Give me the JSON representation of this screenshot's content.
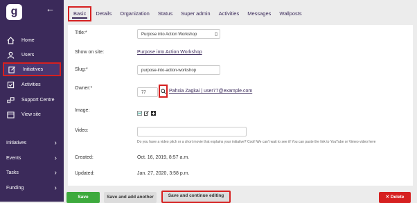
{
  "sidebar": {
    "logo": "g",
    "nav": [
      {
        "label": "Home",
        "icon": "home-icon"
      },
      {
        "label": "Users",
        "icon": "user-icon"
      },
      {
        "label": "Initiatives",
        "icon": "edit-icon"
      },
      {
        "label": "Activities",
        "icon": "checklist-icon"
      },
      {
        "label": "Support Centre",
        "icon": "support-icon"
      },
      {
        "label": "View site",
        "icon": "calendar-icon"
      }
    ],
    "groups": [
      {
        "label": "Initiatives"
      },
      {
        "label": "Events"
      },
      {
        "label": "Tasks"
      },
      {
        "label": "Funding"
      }
    ]
  },
  "tabs": [
    "Basic",
    "Details",
    "Organization",
    "Status",
    "Super admin",
    "Activities",
    "Messages",
    "Wallposts"
  ],
  "form": {
    "title_label": "Title:*",
    "title_value": "Purpose into Action Workshop",
    "show_on_site_label": "Show on site:",
    "show_on_site_value": "Purpose into Action Workshop",
    "slug_label": "Slug:*",
    "slug_value": "purpose-into-action-workshop",
    "owner_label": "Owner:*",
    "owner_id": "77",
    "owner_name": "Pahxia Zagkai | user77@example.com",
    "image_label": "Image:",
    "video_label": "Video:",
    "video_help": "Do you have a video pitch or a short movie that explains your initiative? Cool! We can't wait to see it! You can paste the link to YouTube or Vimeo video here",
    "created_label": "Created:",
    "created_value": "Oct. 16, 2019, 8:57 a.m.",
    "updated_label": "Updated:",
    "updated_value": "Jan. 27, 2020, 3:58 p.m."
  },
  "buttons": {
    "save": "Save",
    "save_add": "Save and add another",
    "save_continue": "Save and continue editing",
    "delete": "✕ Delete"
  }
}
